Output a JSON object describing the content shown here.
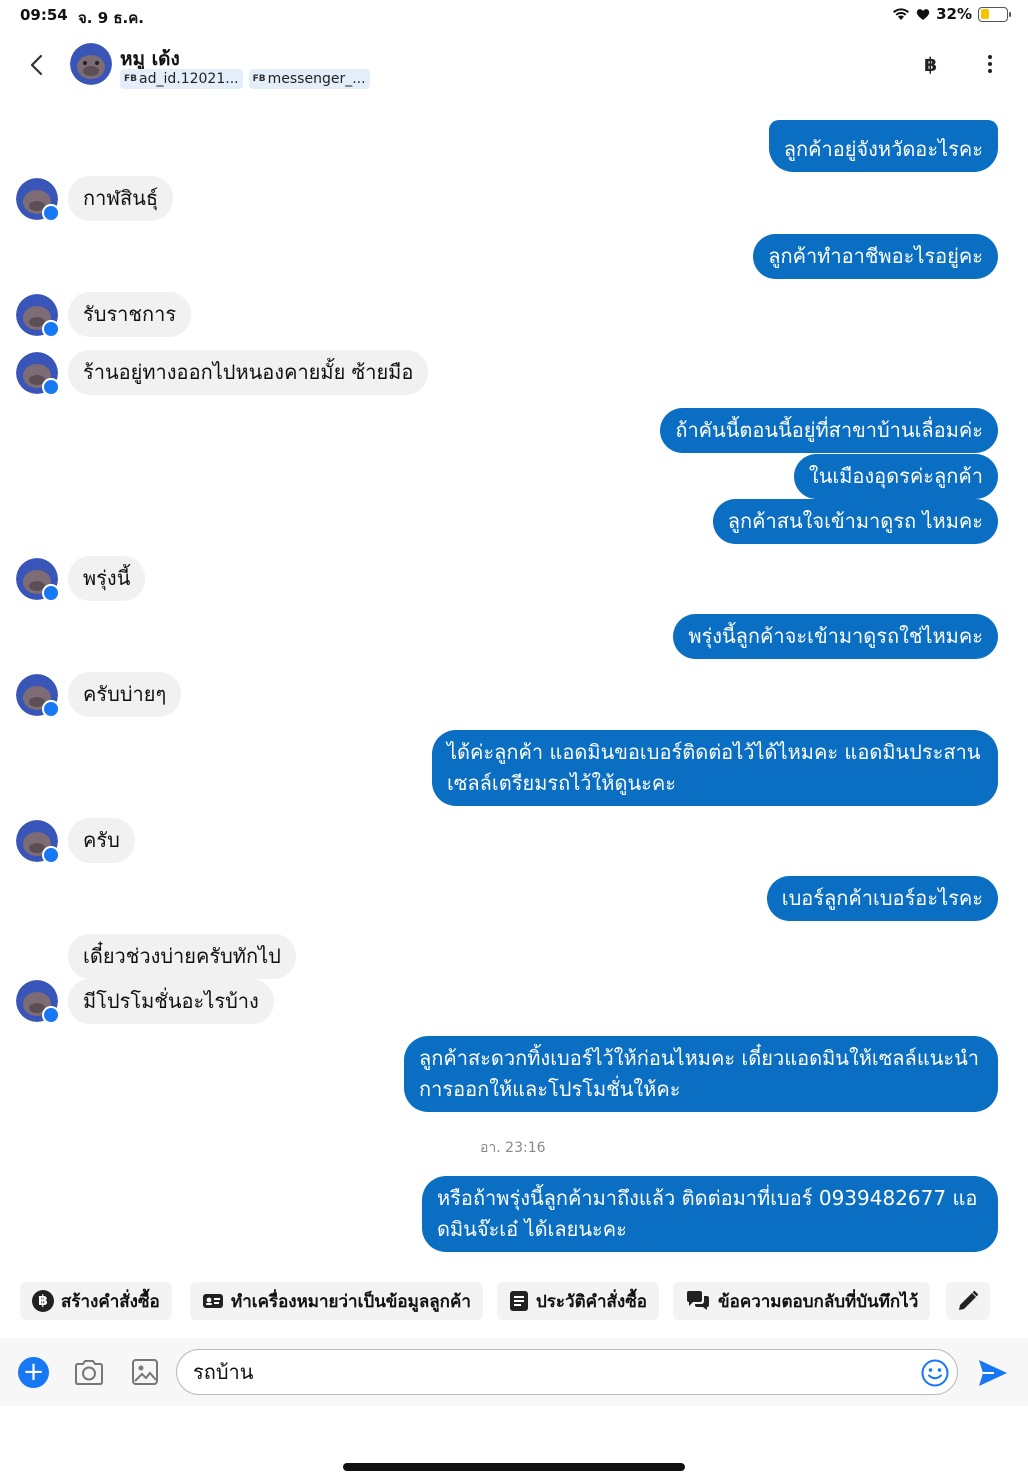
{
  "status_bar": {
    "time": "09:54",
    "date": "จ. 9 ธ.ค.",
    "battery": "32%"
  },
  "header": {
    "contact_name": "หมู เด้ง",
    "tags": [
      "ad_id.12021...",
      "messenger_..."
    ],
    "tag_prefix": "FB",
    "baht_symbol": "฿"
  },
  "messages": [
    {
      "dir": "out",
      "text": "ลูกค้าอยู่จังหวัดอะไรคะ"
    },
    {
      "dir": "in",
      "text": "กาฬสินธุ์"
    },
    {
      "dir": "out",
      "text": "ลูกค้าทำอาชีพอะไรอยู่คะ"
    },
    {
      "dir": "in",
      "text": "รับราชการ"
    },
    {
      "dir": "in",
      "text": "ร้านอยู่ทางออกไปหนองคายมั้ย ซ้ายมือ"
    },
    {
      "dir": "out",
      "text": "ถ้าคันนี้ตอนนี้อยู่ที่สาขาบ้านเลื่อมค่ะ"
    },
    {
      "dir": "out",
      "text": "ในเมืองอุดรค่ะลูกค้า"
    },
    {
      "dir": "out",
      "text": "ลูกค้าสนใจเข้ามาดูรถ ไหมคะ"
    },
    {
      "dir": "in",
      "text": "พรุ่งนี้"
    },
    {
      "dir": "out",
      "text": "พรุ่งนี้ลูกค้าจะเข้ามาดูรถใช่ไหมคะ"
    },
    {
      "dir": "in",
      "text": "ครับบ่ายๆ"
    },
    {
      "dir": "out",
      "text": "ได้ค่ะลูกค้า แอดมินขอเบอร์ติดต่อไว้ได้ไหมคะ แอดมินประสาน\nเซลล์เตรียมรถไว้ให้ดูนะคะ"
    },
    {
      "dir": "in",
      "text": "ครับ"
    },
    {
      "dir": "out",
      "text": "เบอร์ลูกค้าเบอร์อะไรคะ"
    },
    {
      "dir": "in",
      "text": "เดี๋ยวช่วงบ่ายครับทักไป"
    },
    {
      "dir": "in",
      "text": "มีโปรโมชั่นอะไรบ้าง"
    },
    {
      "dir": "out",
      "text": "ลูกค้าสะดวกทิ้งเบอร์ไว้ให้ก่อนไหมคะ เดี๋ยวแอดมินให้เซลล์แนะนำ\nการออกให้และโปรโมชั่นให้คะ"
    },
    {
      "dir": "out",
      "text": "หรือถ้าพรุ่งนี้ลูกค้ามาถึงแล้ว ติดต่อมาที่เบอร์ 0939482677 แอ\nดมินจ๊ะเอ๋ ได้เลยนะคะ"
    }
  ],
  "timestamp": "อา. 23:16",
  "quick_actions": [
    {
      "label": "สร้างคำสั่งซื้อ",
      "icon": "baht-circle-icon"
    },
    {
      "label": "ทำเครื่องหมายว่าเป็นข้อมูลลูกค้า",
      "icon": "id-card-icon"
    },
    {
      "label": "ประวัติคำสั่งซื้อ",
      "icon": "order-history-icon"
    },
    {
      "label": "ข้อความตอบกลับที่บันทึกไว้",
      "icon": "saved-replies-icon"
    }
  ],
  "composer": {
    "input_value": "รถบ้าน"
  },
  "colors": {
    "outgoing_bubble": "#0a6fc2",
    "incoming_bubble": "#f1f1f1",
    "accent": "#1877f2"
  }
}
